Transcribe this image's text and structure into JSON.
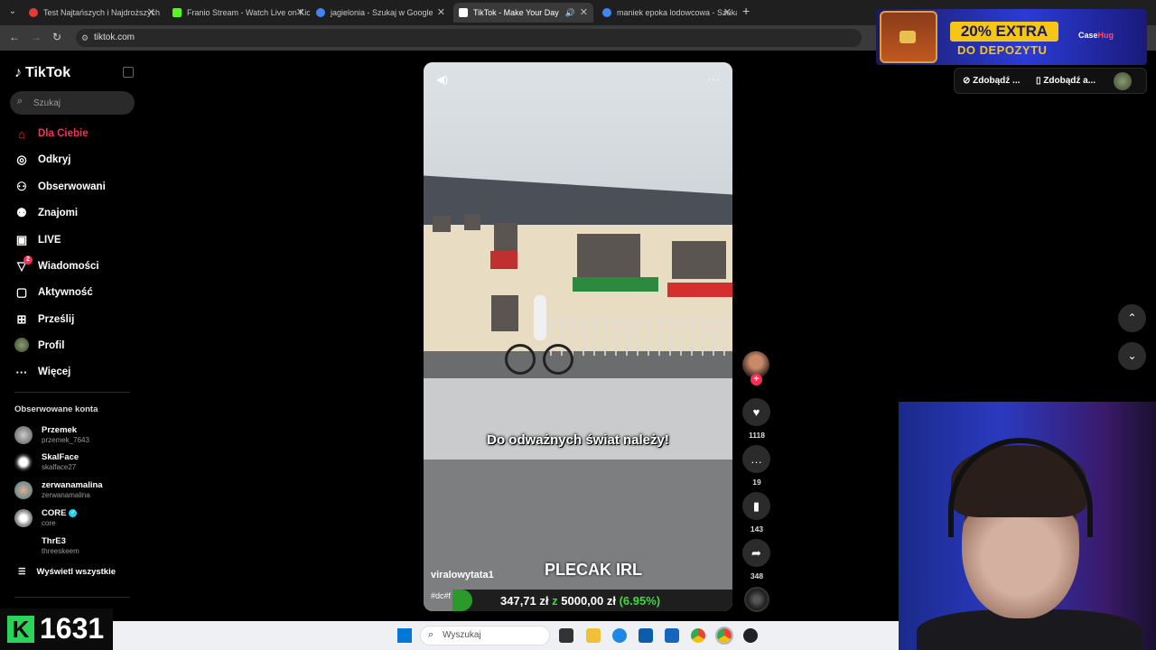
{
  "browser": {
    "tabs": [
      {
        "title": "Test Najtańszych i Najdroższych",
        "active": false,
        "favicon_color": "#e53935"
      },
      {
        "title": "Franio Stream - Watch Live on Kick",
        "active": false,
        "favicon_color": "#53fc18"
      },
      {
        "title": "jagielonia - Szukaj w Google",
        "active": false,
        "favicon_color": "#4285f4"
      },
      {
        "title": "TikTok - Make Your Day",
        "active": true,
        "favicon_color": "#ffffff"
      },
      {
        "title": "maniek epoka lodowcowa - Szukaj",
        "active": false,
        "favicon_color": "#4285f4"
      }
    ],
    "url": "tiktok.com"
  },
  "ad": {
    "badge": "20% EXTRA",
    "subtitle": "DO DEPOZYTU",
    "brand_a": "Case",
    "brand_b": "Hug"
  },
  "sidebar": {
    "logo": "TikTok",
    "search_placeholder": "Szukaj",
    "menu": [
      {
        "label": "Dla Ciebie",
        "icon": "home-icon",
        "active": true
      },
      {
        "label": "Odkryj",
        "icon": "compass-icon",
        "active": false
      },
      {
        "label": "Obserwowani",
        "icon": "following-icon",
        "active": false
      },
      {
        "label": "Znajomi",
        "icon": "friends-icon",
        "active": false
      },
      {
        "label": "LIVE",
        "icon": "live-icon",
        "active": false
      },
      {
        "label": "Wiadomości",
        "icon": "messages-icon",
        "active": false,
        "badge": "2"
      },
      {
        "label": "Aktywność",
        "icon": "activity-icon",
        "active": false
      },
      {
        "label": "Prześlij",
        "icon": "upload-icon",
        "active": false
      },
      {
        "label": "Profil",
        "icon": "profile-icon",
        "active": false
      },
      {
        "label": "Więcej",
        "icon": "more-icon",
        "active": false
      }
    ],
    "followed_title": "Obserwowane konta",
    "accounts": [
      {
        "name": "Przemek",
        "handle": "przemek_7643",
        "verified": false
      },
      {
        "name": "SkalFace",
        "handle": "skalface27",
        "verified": false
      },
      {
        "name": "zerwanamalina",
        "handle": "zerwanamalina",
        "verified": false
      },
      {
        "name": "CORE",
        "handle": "core",
        "verified": true
      },
      {
        "name": "ThrE3",
        "handle": "threeskeem",
        "verified": false
      }
    ],
    "show_all": "Wyświetl wszystkie"
  },
  "video": {
    "caption": "Do odważnych świat należy!",
    "author": "viralowytata1",
    "tags": "#dc#f",
    "overlay_title": "PLECAK IRL",
    "progress": {
      "amount": "347,71 zł",
      "word": "z",
      "goal": "5000,00 zł",
      "percent_text": "(6.95%)",
      "fraction": 0.0695
    }
  },
  "actions": {
    "likes": "1118",
    "comments": "19",
    "saves": "143",
    "shares": "348"
  },
  "top_right": {
    "get_coins": "Zdobądź ...",
    "get_app": "Zdobądź a..."
  },
  "taskbar": {
    "search_placeholder": "Wyszukaj"
  },
  "counter": {
    "badge_letter": "K",
    "value": "1631"
  }
}
